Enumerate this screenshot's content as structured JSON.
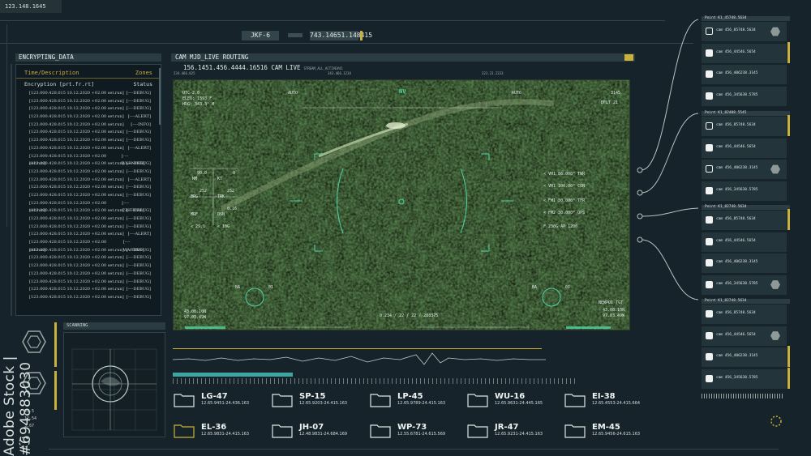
{
  "top_left_readout": "123.148.1645",
  "top_tags": {
    "code": "JKF-6",
    "value": "743.14651.148415"
  },
  "encrypt": {
    "title": "ENCRYPTING_DATA",
    "col1": "Time/Description",
    "col2": "Zones",
    "sub1": "Encryption [prt.fr.rt]",
    "sub2": "Status",
    "rows": [
      {
        "t": "[123.000.428.015 10.12.2020 +02.00 set.run]",
        "s": "[----DEBUG]"
      },
      {
        "t": "[123.000.428.015 10.12.2020 +02.00 set.run]",
        "s": "[----DEBUG]"
      },
      {
        "t": "[123.000.428.015 10.12.2020 +02.00 set.run]",
        "s": "[----DEBUG]"
      },
      {
        "t": "[123.000.428.015 10.12.2020 +02.00 set.run]",
        "s": "[----ALERT]"
      },
      {
        "t": "[123.000.428.015 10.12.2020 +02.00 set.run]",
        "s": "[----INFO]"
      },
      {
        "t": "[123.000.428.015 10.12.2020 +02.00 set.run]",
        "s": "[----DEBUG]"
      },
      {
        "t": "[123.000.428.015 10.12.2020 +02.00 set.run]",
        "s": "[----DEBUG]"
      },
      {
        "t": "[123.000.428.015 10.12.2020 +02.00 set.run]",
        "s": "[----ALERT]"
      },
      {
        "t": "[123.000.428.015 10.12.2020 +02.00 set.run]",
        "s": "[----WARNING]"
      },
      {
        "t": "[123.000.428.015 10.12.2020 +02.00 set.run]",
        "s": "[----DEBUG]"
      },
      {
        "t": "[123.000.428.015 10.12.2020 +02.00 set.run]",
        "s": "[----DEBUG]"
      },
      {
        "t": "[123.000.428.015 10.12.2020 +02.00 set.run]",
        "s": "[----ALERT]"
      },
      {
        "t": "[123.000.428.015 10.12.2020 +02.00 set.run]",
        "s": "[----DEBUG]"
      },
      {
        "t": "[123.000.428.015 10.12.2020 +02.00 set.run]",
        "s": "[----DEBUG]"
      },
      {
        "t": "[123.000.428.015 10.12.2020 +02.00 set.run]",
        "s": "[----CRITICAL]"
      },
      {
        "t": "[123.000.428.015 10.12.2020 +02.00 set.run]",
        "s": "[----DEBUG]"
      },
      {
        "t": "[123.000.428.015 10.12.2020 +02.00 set.run]",
        "s": "[----DEBUG]"
      },
      {
        "t": "[123.000.428.015 10.12.2020 +02.00 set.run]",
        "s": "[----DEBUG]"
      },
      {
        "t": "[123.000.428.015 10.12.2020 +02.00 set.run]",
        "s": "[----ALERT]"
      },
      {
        "t": "[123.000.428.015 10.12.2020 +02.00 set.run]",
        "s": "[----WAITING]"
      },
      {
        "t": "[123.000.428.015 10.12.2020 +02.00 set.run]",
        "s": "[----DEBUG]"
      },
      {
        "t": "[123.000.428.015 10.12.2020 +02.00 set.run]",
        "s": "[----DEBUG]"
      },
      {
        "t": "[123.000.428.015 10.12.2020 +02.00 set.run]",
        "s": "[----DEBUG]"
      },
      {
        "t": "[123.000.428.015 10.12.2020 +02.00 set.run]",
        "s": "[----DEBUG]"
      },
      {
        "t": "[123.000.428.015 10.12.2020 +02.00 set.run]",
        "s": "[----DEBUG]"
      },
      {
        "t": "[123.000.428.015 10.12.2020 +02.00 set.run]",
        "s": "[----DEBUG]"
      },
      {
        "t": "[123.000.428.015 10.12.2020 +02.00 set.run]",
        "s": "[----DEBUG]"
      }
    ]
  },
  "cam": {
    "title": "CAM MJD_LIVE ROUTING",
    "subtitle": "156.1451.456.4444.16516 CAM LIVE",
    "stream": "STREAM_ALL_ACTIVE#41",
    "ticks": [
      "234.466.025",
      "343.466.1234",
      "323.23.2233"
    ],
    "hud": {
      "utc": "UTC-2.0",
      "elev": "ELEV:   1593 F",
      "hdg": "HDG:   343.3° M",
      "auto_l": "AUTO",
      "auto_r": "AUTO",
      "nv": "NV",
      "r1": "3145",
      "r2": "DFLT    21",
      "nm_v": "90.0",
      "nm": "NM",
      "kt_v": "0",
      "kt": "KT",
      "brg_v": "252",
      "brg": "BRG",
      "trk_v": "252",
      "trk": "TRK",
      "mrf": "MRF",
      "dsn_v": "0.16",
      "dsn": "DSN",
      "z1": "< 29.1",
      "z2": "< 10G",
      "v1": "< VH1   86.000°   TWR",
      "v2": "< VH1   100.00°   CON",
      "v3": "< FM1   30.000°   TFR",
      "v4": "< FM2   30.000°   OPS",
      "v5": "F   230G   AP   1200",
      "ba_l": "BA",
      "n01_l": "01",
      "ba_r": "BA",
      "n01_r": "01",
      "lat": "43.08.10N",
      "lon": "97.03.49W",
      "center": "0.234 / 22 / 22 / 288375",
      "newpoi": "NEWPOI TGT",
      "lat_r": "43.08.10N",
      "lon_r": "97.03.49W"
    }
  },
  "scanning": {
    "title": "SCANNING"
  },
  "vertical_text": "Adobe Stock | #694883030",
  "left_small": [
    "23.5",
    "12.54",
    "3.67"
  ],
  "groups": [
    {
      "header": "Point K1_45748.5634",
      "items": [
        {
          "label": "cam 456_85748.5634",
          "fill": false,
          "hex": true,
          "mark": false
        },
        {
          "label": "cam 456_44546.5654",
          "fill": true,
          "hex": false,
          "mark": true
        },
        {
          "label": "cam 456_406238.3145",
          "fill": true,
          "hex": false,
          "mark": false
        },
        {
          "label": "cam 456_345638.5785",
          "fill": true,
          "hex": false,
          "mark": false
        }
      ]
    },
    {
      "header": "Point K1_82408.5545",
      "items": [
        {
          "label": "cam 456_85748.5634",
          "fill": false,
          "hex": false,
          "mark": true
        },
        {
          "label": "cam 456_44546.5654",
          "fill": true,
          "hex": false,
          "mark": false
        },
        {
          "label": "cam 456_406238.3145",
          "fill": false,
          "hex": true,
          "mark": false
        },
        {
          "label": "cam 456_345638.5785",
          "fill": true,
          "hex": false,
          "mark": false
        }
      ]
    },
    {
      "header": "Point K1_82748.5634",
      "items": [
        {
          "label": "cam 456_85748.5634",
          "fill": true,
          "hex": false,
          "mark": true
        },
        {
          "label": "cam 456_44546.5654",
          "fill": true,
          "hex": false,
          "mark": false
        },
        {
          "label": "cam 456_406238.3145",
          "fill": true,
          "hex": false,
          "mark": false
        },
        {
          "label": "cam 456_345638.5785",
          "fill": true,
          "hex": true,
          "mark": false
        }
      ]
    },
    {
      "header": "Point K1_82748.5634",
      "items": [
        {
          "label": "cam 456_85748.5634",
          "fill": true,
          "hex": false,
          "mark": false
        },
        {
          "label": "cam 456_44546.5654",
          "fill": true,
          "hex": true,
          "mark": false
        },
        {
          "label": "cam 456_406238.3145",
          "fill": true,
          "hex": false,
          "mark": true
        },
        {
          "label": "cam 456_345638.5785",
          "fill": true,
          "hex": false,
          "mark": true
        }
      ]
    }
  ],
  "folders": [
    {
      "code": "LG-47",
      "coords": "12.65.9451-24.436.163",
      "accent": false
    },
    {
      "code": "SP-15",
      "coords": "12.65.9203-24.415.163",
      "accent": false
    },
    {
      "code": "LP-45",
      "coords": "12.65.9789-24.415.163",
      "accent": false
    },
    {
      "code": "WU-16",
      "coords": "12.65.9631-24.445.165",
      "accent": false
    },
    {
      "code": "EI-38",
      "coords": "12.65.4553-24.415.664",
      "accent": false
    },
    {
      "code": "EL-36",
      "coords": "12.65.9831-24.415.163",
      "accent": true
    },
    {
      "code": "JH-07",
      "coords": "12.48.9831-24.684.169",
      "accent": false
    },
    {
      "code": "WP-73",
      "coords": "12.55.6781-24.615.569",
      "accent": false
    },
    {
      "code": "JR-47",
      "coords": "12.65.9231-24.415.163",
      "accent": false
    },
    {
      "code": "EM-45",
      "coords": "12.65.9456-24.615.163",
      "accent": false
    }
  ],
  "colors": {
    "accent_yellow": "#c9b13a",
    "hud_green": "#4fd6a4",
    "panel": "#24343b",
    "bg": "#16232a"
  }
}
